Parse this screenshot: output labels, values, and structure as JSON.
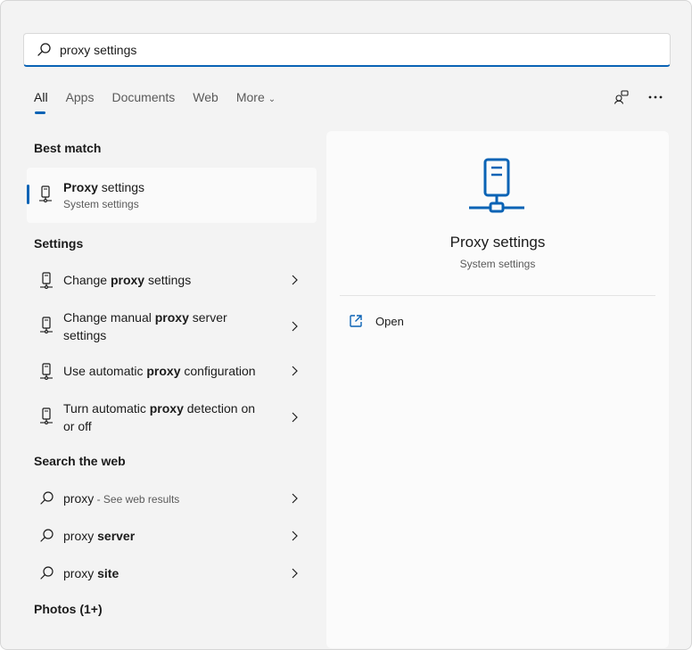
{
  "search": {
    "value": "proxy settings",
    "placeholder": ""
  },
  "tabs": [
    {
      "label": "All"
    },
    {
      "label": "Apps"
    },
    {
      "label": "Documents"
    },
    {
      "label": "Web"
    },
    {
      "label": "More"
    }
  ],
  "sections": {
    "best_match": "Best match",
    "settings": "Settings",
    "search_web": "Search the web",
    "photos": "Photos (1+)"
  },
  "best": {
    "title_bold": "Proxy",
    "title_rest": " settings",
    "subtitle": "System settings"
  },
  "settings_items": [
    {
      "pre": "Change ",
      "bold": "proxy",
      "post": " settings"
    },
    {
      "pre": "Change manual ",
      "bold": "proxy",
      "post": " server settings"
    },
    {
      "pre": "Use automatic ",
      "bold": "proxy",
      "post": " configuration"
    },
    {
      "pre": "Turn automatic ",
      "bold": "proxy",
      "post": " detection on or off"
    }
  ],
  "web_items": [
    {
      "pre": "proxy",
      "bold": "",
      "post": "",
      "sub": " - See web results"
    },
    {
      "pre": "proxy ",
      "bold": "server",
      "post": "",
      "sub": ""
    },
    {
      "pre": "proxy ",
      "bold": "site",
      "post": "",
      "sub": ""
    }
  ],
  "preview": {
    "title": "Proxy settings",
    "subtitle": "System settings",
    "open_label": "Open"
  },
  "colors": {
    "accent": "#0a63b5"
  }
}
